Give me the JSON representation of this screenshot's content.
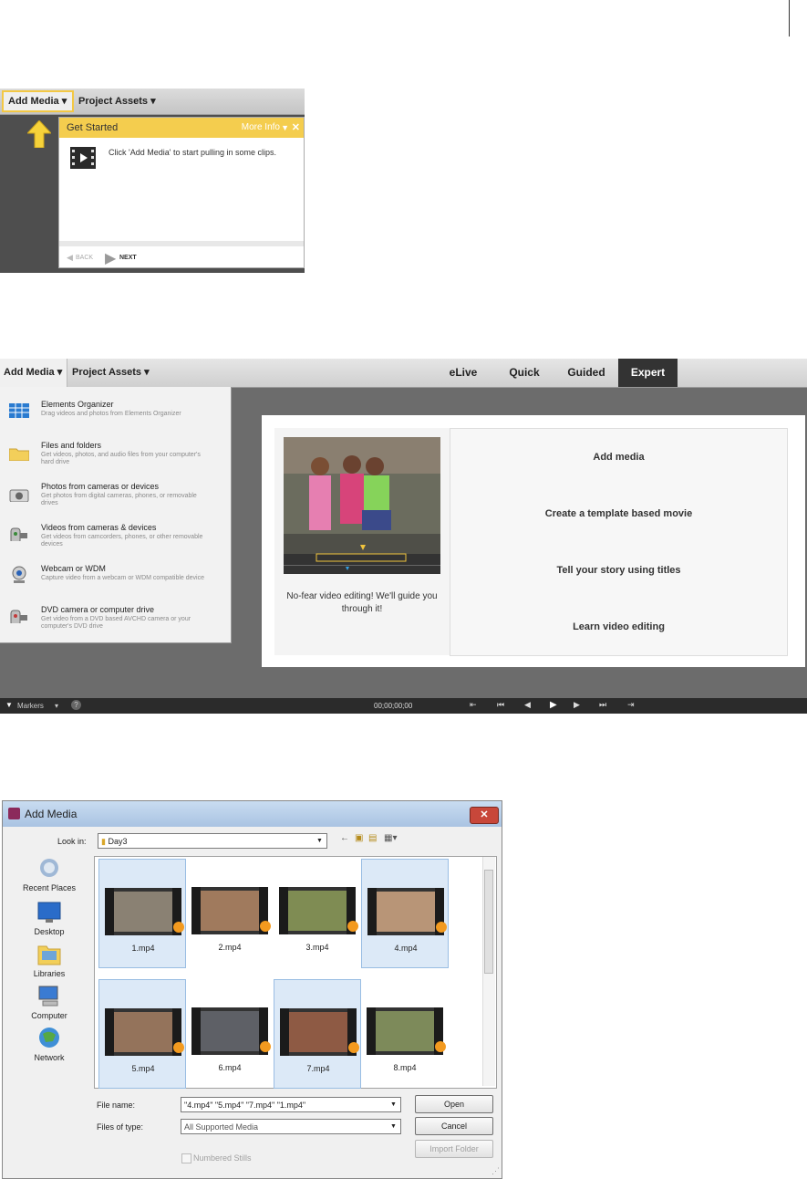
{
  "panel1": {
    "tabs": [
      "Add Media",
      "Project Assets"
    ],
    "card": {
      "title": "Get Started",
      "more_info": "More Info",
      "message": "Click 'Add Media' to start pulling in some clips.",
      "back": "BACK",
      "next": "NEXT"
    }
  },
  "panel2": {
    "tabs": [
      "Add Media",
      "Project Assets"
    ],
    "modes": [
      "eLive",
      "Quick",
      "Guided",
      "Expert"
    ],
    "menu": [
      {
        "title": "Elements Organizer",
        "desc": "Drag videos and photos from Elements Organizer"
      },
      {
        "title": "Files and folders",
        "desc": "Get videos, photos, and audio files from your computer's hard drive"
      },
      {
        "title": "Photos from cameras or devices",
        "desc": "Get photos from digital cameras, phones, or removable drives"
      },
      {
        "title": "Videos from cameras & devices",
        "desc": "Get videos from camcorders, phones, or other removable devices"
      },
      {
        "title": "Webcam or WDM",
        "desc": "Capture video from a webcam or WDM compatible device"
      },
      {
        "title": "DVD camera or computer drive",
        "desc": "Get video from a DVD based AVCHD camera or your computer's DVD drive"
      }
    ],
    "welcome": {
      "caption": "No-fear video editing! We'll guide you through it!",
      "options": [
        "Add media",
        "Create a template based movie",
        "Tell your story using titles",
        "Learn video editing"
      ]
    },
    "timeline": {
      "markers": "Markers",
      "timecode": "00;00;00;00"
    }
  },
  "panel3": {
    "title": "Add Media",
    "look_in_label": "Look in:",
    "look_in_value": "Day3",
    "places": [
      "Recent Places",
      "Desktop",
      "Libraries",
      "Computer",
      "Network"
    ],
    "files": [
      "1.mp4",
      "2.mp4",
      "3.mp4",
      "4.mp4",
      "5.mp4",
      "6.mp4",
      "7.mp4",
      "8.mp4"
    ],
    "file_name_label": "File name:",
    "file_name_value": "\"4.mp4\" \"5.mp4\" \"7.mp4\" \"1.mp4\"",
    "files_of_type_label": "Files of type:",
    "files_of_type_value": "All Supported Media",
    "numbered_stills": "Numbered Stills",
    "buttons": {
      "open": "Open",
      "cancel": "Cancel",
      "import_folder": "Import Folder"
    }
  }
}
